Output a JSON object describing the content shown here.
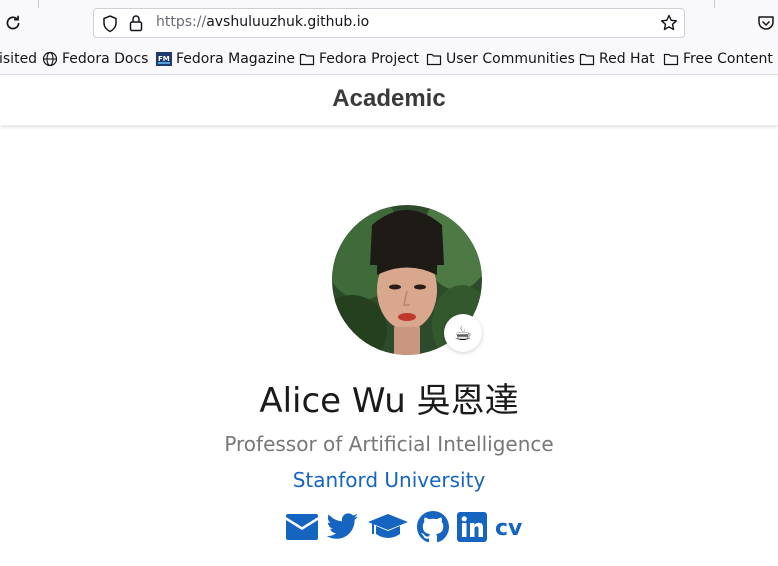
{
  "browser": {
    "url_protocol": "https://",
    "url_host": "avshuluuzhuk.github.io",
    "bookmarks": [
      {
        "label": "isited",
        "icon": "none"
      },
      {
        "label": "Fedora Docs",
        "icon": "globe-icon"
      },
      {
        "label": "Fedora Magazine",
        "icon": "fm-icon"
      },
      {
        "label": "Fedora Project",
        "icon": "folder-icon"
      },
      {
        "label": "User Communities",
        "icon": "folder-icon"
      },
      {
        "label": "Red Hat",
        "icon": "folder-icon"
      },
      {
        "label": "Free Content",
        "icon": "folder-icon"
      }
    ]
  },
  "site": {
    "title": "Academic"
  },
  "profile": {
    "status_emoji": "☕",
    "name": "Alice Wu 吳恩達",
    "role": "Professor of Artificial Intelligence",
    "organization": "Stanford University",
    "cv_label": "cv"
  },
  "social_icons": [
    "envelope-icon",
    "twitter-icon",
    "graduation-cap-icon",
    "github-icon",
    "linkedin-icon"
  ],
  "colors": {
    "accent": "#1565c0",
    "title": "#3a3a3a",
    "role": "#777777"
  }
}
